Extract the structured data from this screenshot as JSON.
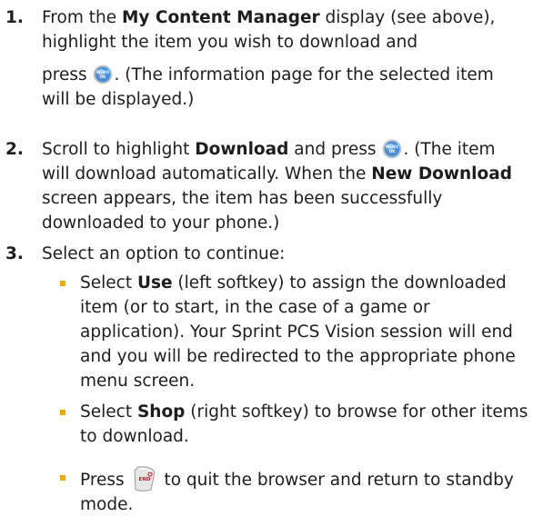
{
  "steps": [
    {
      "number": "1.",
      "line1_pre": "From the ",
      "line1_bold": "My Content Manager",
      "line1_post": " display (see above),",
      "line2": "highlight the item you wish to download and",
      "line3_pre": "press ",
      "line3_post": ". (The information page for the selected item",
      "line4": "will be displayed.)"
    },
    {
      "number": "2.",
      "line1_pre": "Scroll to highlight ",
      "line1_bold": "Download",
      "line1_mid": " and press ",
      "line1_post": ". (The item",
      "line2_pre": "will download automatically. When the ",
      "line2_bold": "New Download",
      "line3": "screen appears, the item has been successfully",
      "line4": "downloaded to your phone.)"
    },
    {
      "number": "3.",
      "line1": "Select an option to continue:"
    }
  ],
  "bullets": [
    {
      "line1_pre": "Select ",
      "line1_bold": "Use",
      "line1_post": " (left softkey) to assign the downloaded",
      "line2": "item (or to start, in the case of a game or",
      "line3": "application). Your Sprint PCS Vision session will end",
      "line4": "and you will be redirected to the appropriate phone",
      "line5": "menu screen."
    },
    {
      "line1_pre": "Select ",
      "line1_bold": "Shop",
      "line1_post": " (right softkey) to browse for other items",
      "line2": "to download."
    },
    {
      "line1_pre": "Press ",
      "line1_post": " to quit the browser and return to standby",
      "line2": "mode."
    }
  ],
  "icons": {
    "menu_ok_key": "menu-ok-key-icon",
    "menu_ok_top": "MENU",
    "menu_ok_bottom": "OK",
    "end_key": "end-key-icon",
    "end_label": "END",
    "accent_color": "#f2a900",
    "key_blue": "#4a90d9"
  }
}
